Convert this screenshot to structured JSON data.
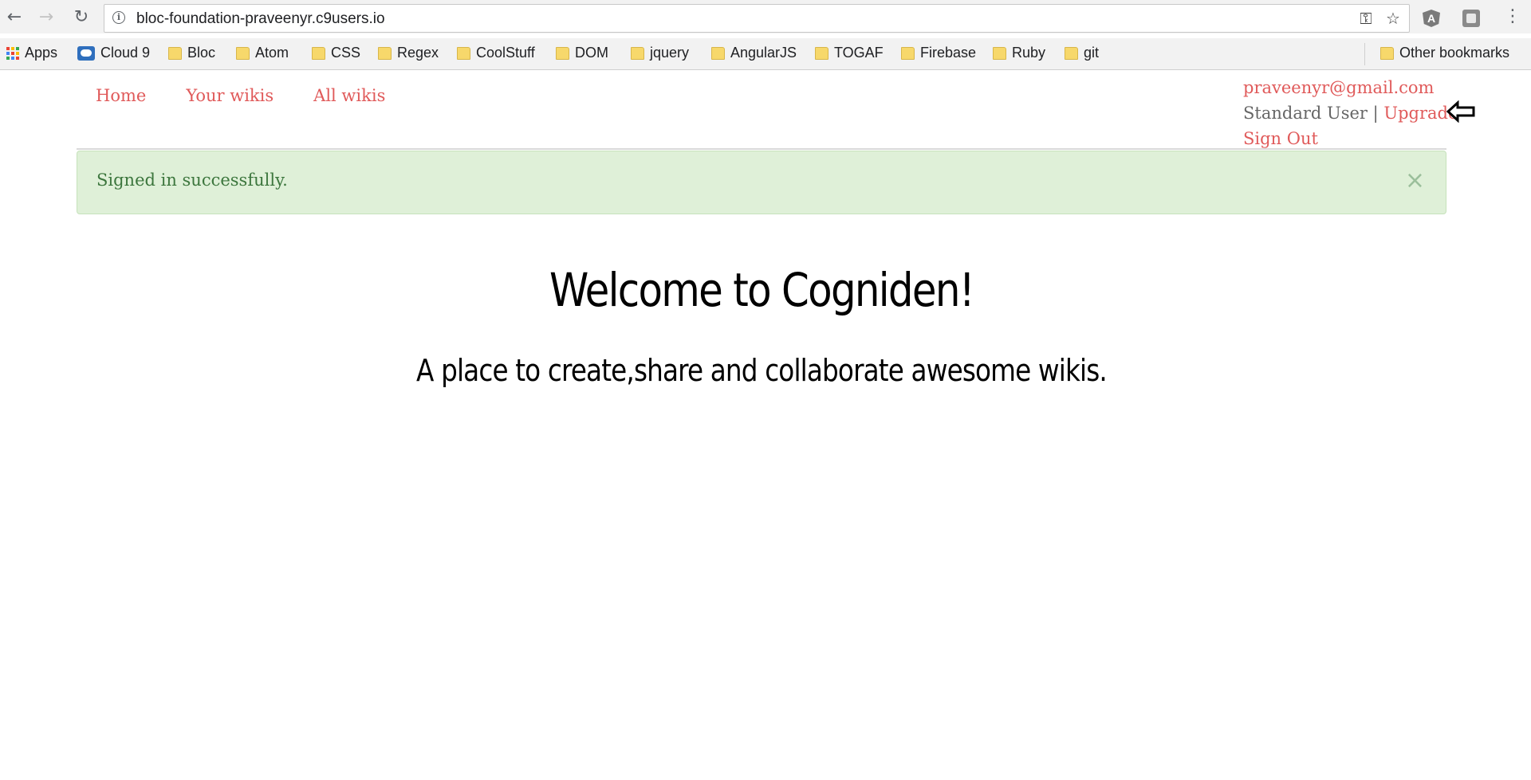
{
  "browser": {
    "url": "bloc-foundation-praveenyr.c9users.io",
    "back_glyph": "←",
    "forward_glyph": "→",
    "reload_glyph": "↻",
    "key_glyph": "⚿",
    "star_glyph": "☆",
    "extension_a_label": "A",
    "menu_glyph": "⋮",
    "info_glyph": "i"
  },
  "bookmarks": {
    "items": [
      {
        "label": "Apps",
        "icon": "apps-icon"
      },
      {
        "label": "Cloud 9",
        "icon": "cloud9-icon"
      },
      {
        "label": "Bloc",
        "icon": "folder-icon"
      },
      {
        "label": "Atom",
        "icon": "folder-icon"
      },
      {
        "label": "CSS",
        "icon": "folder-icon"
      },
      {
        "label": "Regex",
        "icon": "folder-icon"
      },
      {
        "label": "CoolStuff",
        "icon": "folder-icon"
      },
      {
        "label": "DOM",
        "icon": "folder-icon"
      },
      {
        "label": "jquery",
        "icon": "folder-icon"
      },
      {
        "label": "AngularJS",
        "icon": "folder-icon"
      },
      {
        "label": "TOGAF",
        "icon": "folder-icon"
      },
      {
        "label": "Firebase",
        "icon": "folder-icon"
      },
      {
        "label": "Ruby",
        "icon": "folder-icon"
      },
      {
        "label": "git",
        "icon": "folder-icon"
      }
    ],
    "other": "Other bookmarks"
  },
  "nav": {
    "home": "Home",
    "your_wikis": "Your wikis",
    "all_wikis": "All wikis"
  },
  "user": {
    "email": "praveenyr@gmail.com",
    "role": "Standard User",
    "separator": " | ",
    "upgrade": "Upgrade",
    "sign_out": "Sign Out"
  },
  "alert": {
    "message": "Signed in successfully.",
    "close_glyph": "×"
  },
  "hero": {
    "title": "Welcome to Cogniden!",
    "subtitle": "A place to create,share and collaborate awesome wikis."
  },
  "colors": {
    "link": "#e05a5a",
    "alert_bg": "#dff0d8",
    "alert_text": "#3c763d",
    "chrome_bg": "#f2f2f2"
  }
}
